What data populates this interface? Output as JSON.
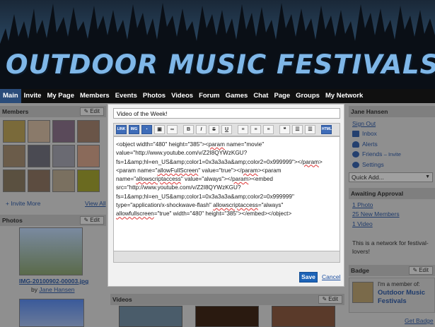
{
  "banner": {
    "title": "OUTDOOR MUSIC FESTIVALS"
  },
  "nav": {
    "tabs": [
      "Main",
      "Invite",
      "My Page",
      "Members",
      "Events",
      "Photos",
      "Videos",
      "Forum",
      "Games",
      "Chat",
      "Page",
      "Groups",
      "My Network"
    ],
    "active": "Main"
  },
  "left": {
    "members_title": "Members",
    "edit_label": "Edit",
    "invite_more": "+ Invite More",
    "view_all": "View All",
    "photos_title": "Photos",
    "photo_caption": "IMG-20100902-00003.jpg",
    "photo_by": "by",
    "photo_author": "Jane Hansen"
  },
  "center": {
    "videos_title": "Videos",
    "edit_label": "Edit"
  },
  "right": {
    "user_name": "Jane Hansen",
    "sign_out": "Sign Out",
    "inbox": "Inbox",
    "alerts": "Alerts",
    "friends": "Friends",
    "friends_invite": "– Invite",
    "settings": "Settings",
    "quick_add": "Quick Add...",
    "awaiting_title": "Awaiting Approval",
    "awaiting_photo": "1 Photo",
    "awaiting_members": "25 New Members",
    "awaiting_video": "1 Video",
    "about": "This is a network for festival-lovers!",
    "badge_title": "Badge",
    "edit_label": "Edit",
    "badge_member": "I'm a member of:",
    "badge_network": "Outdoor Music Festivals",
    "get_badge": "Get Badge"
  },
  "modal": {
    "title_value": "Video of the Week!",
    "save_label": "Save",
    "cancel_label": "Cancel",
    "toolbar_html_label": "HTML",
    "embed_parts": [
      "<object width=\"480\" height=\"385\"><",
      "param",
      " name=\"movie\" value=\"http://www.youtube.com/v/Z2I8QYWzKGU?fs=1&amp;hl=en_US&amp;color1=0x3a3a3a&amp;color2=0x999999\"></",
      "param",
      "><param name=\"",
      "allowFullScreen",
      "\" value=\"true\"></",
      "param",
      "><param name=\"",
      "allowscriptaccess",
      "\" value=\"always\"></",
      "param",
      "><embed src=\"http://www.youtube.com/v/Z2I8QYWzKGU?fs=1&amp;hl=en_US&amp;color1=0x3a3a3a&amp;color2=0x999999\" type=\"application/x-shockwave-flash\" ",
      "allowscriptaccess",
      "=\"always\" ",
      "allowfullscreen",
      "=\"true\" width=\"480\" height=\"385\"></embed></object>"
    ]
  },
  "colors": {
    "accent": "#1d63b7",
    "nav_active": "#2a4c7a",
    "link": "#1f3b6b"
  }
}
